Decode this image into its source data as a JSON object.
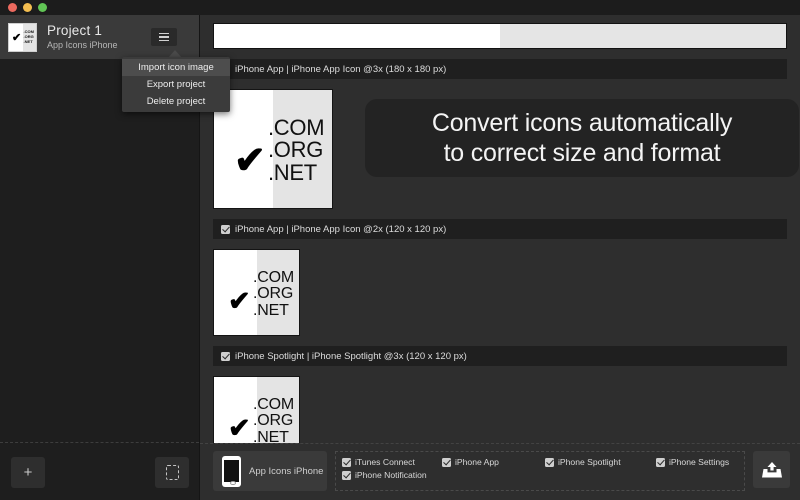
{
  "window": {
    "traffic_lights": [
      "close",
      "minimize",
      "zoom"
    ],
    "colors": {
      "close": "#ec6a5f",
      "minimize": "#f4be50",
      "zoom": "#61c555",
      "sidebar_bg": "#1e1e1e",
      "main_bg": "#2e2e2e",
      "row_header_bg": "#1f1f1f",
      "menu_bg": "#3b3b3b",
      "accent_text": "#ededed"
    }
  },
  "sidebar": {
    "project": {
      "title": "Project 1",
      "subtitle": "App Icons iPhone",
      "thumbnail_lines": [
        ".COM",
        ".ORG",
        ".NET"
      ],
      "menu_button_icon": "hamburger-icon"
    },
    "footer": {
      "add_button_label": "+",
      "placeholder_button_icon": "dashed-square-icon"
    }
  },
  "menu": {
    "items": [
      {
        "label": "Import icon image",
        "highlighted": true
      },
      {
        "label": "Export project",
        "highlighted": false
      },
      {
        "label": "Delete project",
        "highlighted": false
      }
    ]
  },
  "callout": {
    "text": "Convert icons automatically\nto correct size and format"
  },
  "icon_art": {
    "check_glyph": "✔",
    "domains": [
      ".COM",
      ".ORG",
      ".NET"
    ],
    "left_color": "#ffffff",
    "right_color": "#e4e4e4"
  },
  "rows": [
    {
      "checked": true,
      "label": "iPhone App | iPhone App Icon @3x (180 x 180 px)",
      "size_label": "180 x 180 px",
      "scale": "@3x"
    },
    {
      "checked": true,
      "label": "iPhone App | iPhone App Icon @2x (120 x 120 px)",
      "size_label": "120 x 120 px",
      "scale": "@2x"
    },
    {
      "checked": true,
      "label": "iPhone Spotlight | iPhone Spotlight @3x (120 x 120 px)",
      "size_label": "120 x 120 px",
      "scale": "@3x"
    }
  ],
  "bottom_bar": {
    "device": {
      "name": "App Icons iPhone",
      "icon": "iphone-icon"
    },
    "targets": [
      {
        "label": "iTunes Connect",
        "checked": true
      },
      {
        "label": "iPhone App",
        "checked": true
      },
      {
        "label": "iPhone Spotlight",
        "checked": true
      },
      {
        "label": "iPhone Notification",
        "checked": true
      },
      {
        "label": "iPhone Settings",
        "checked": true
      }
    ],
    "export_button_icon": "export-tray-up-icon"
  }
}
